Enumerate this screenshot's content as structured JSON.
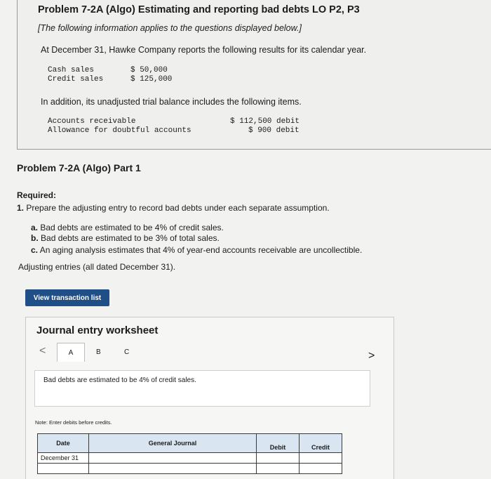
{
  "problem": {
    "title": "Problem 7-2A (Algo) Estimating and reporting bad debts LO P2, P3",
    "subtitle": "[The following information applies to the questions displayed below.]",
    "intro": "At December 31, Hawke Company reports the following results for its calendar year.",
    "sales": [
      {
        "label": "Cash sales",
        "value": "$ 50,000"
      },
      {
        "label": "Credit sales",
        "value": "$ 125,000"
      }
    ],
    "addition": "In addition, its unadjusted trial balance includes the following items.",
    "trial_balance": [
      {
        "label": "Accounts receivable",
        "value": "$ 112,500 debit"
      },
      {
        "label": "Allowance for doubtful accounts",
        "value": "$ 900 debit"
      }
    ]
  },
  "part": {
    "title": "Problem 7-2A (Algo) Part 1",
    "required_label": "Required:",
    "req_num": "1.",
    "req_text": "Prepare the adjusting entry to record bad debts under each separate assumption.",
    "options": [
      {
        "letter": "a.",
        "text": "Bad debts are estimated to be 4% of credit sales."
      },
      {
        "letter": "b.",
        "text": "Bad debts are estimated to be 3% of total sales."
      },
      {
        "letter": "c.",
        "text": "An aging analysis estimates that 4% of year-end accounts receivable are uncollectible."
      }
    ],
    "adjusting_note": "Adjusting entries (all dated December 31)."
  },
  "view_button": "View transaction list",
  "worksheet": {
    "title": "Journal entry worksheet",
    "tabs": [
      "A",
      "B",
      "C"
    ],
    "prev": "<",
    "next": ">",
    "description": "Bad debts are estimated to be 4% of credit sales.",
    "note": "Note: Enter debits before credits.",
    "columns": {
      "date": "Date",
      "journal": "General Journal",
      "debit": "Debit",
      "credit": "Credit"
    },
    "first_date": "December 31"
  }
}
